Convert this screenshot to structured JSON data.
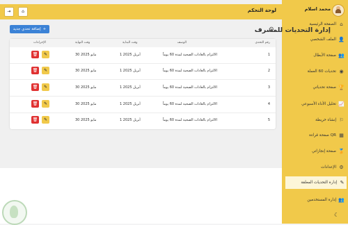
{
  "user": {
    "name": "محمد اسلام"
  },
  "topbar": {
    "title": "لوحة التحكم",
    "home_icon": "home-icon",
    "logout_icon": "logout-icon"
  },
  "sidebar": {
    "items": [
      {
        "label": "الصفحة الرئيسية",
        "icon": "home-icon"
      },
      {
        "label": "الملف الشخصي",
        "icon": "user-icon"
      },
      {
        "label": "صفحة الأبطال",
        "icon": "users-icon"
      },
      {
        "label": "تحديات 60 العملة",
        "icon": "coin-icon"
      },
      {
        "label": "صفحة تحدياتي",
        "icon": "trophy-icon"
      },
      {
        "label": "تحليل الأداء الأسبوعي",
        "icon": "chart-icon"
      },
      {
        "label": "إنشاء خريطة",
        "icon": "map-icon"
      },
      {
        "label": "صفحة قراءة QR",
        "icon": "qr-icon"
      },
      {
        "label": "صفحة إنجازاتي",
        "icon": "medal-icon"
      },
      {
        "label": "الإعدادات",
        "icon": "settings-icon"
      },
      {
        "label": "إدارة التحديات المعلقة",
        "icon": "edit-icon"
      },
      {
        "label": "إدارة المستخدمين",
        "icon": "users-icon"
      }
    ]
  },
  "page": {
    "title": "إدارة التحديات للمشرف",
    "add_button": "إضافة تحدي جديد"
  },
  "table": {
    "headers": [
      "رقم التحدي",
      "الوصف",
      "وقت البداية",
      "وقت النهاية",
      "الإجراءات"
    ],
    "rows": [
      {
        "id": "1",
        "desc": "الالتزام بالعادات الصحية لمدة 60 يوماً",
        "start": "1 أبريل 2025",
        "end": "30 مايو 2025"
      },
      {
        "id": "2",
        "desc": "الالتزام بالعادات الصحية لمدة 60 يوماً",
        "start": "1 أبريل 2025",
        "end": "30 مايو 2025"
      },
      {
        "id": "3",
        "desc": "الالتزام بالعادات الصحية لمدة 60 يوماً",
        "start": "1 أبريل 2025",
        "end": "30 مايو 2025"
      },
      {
        "id": "4",
        "desc": "الالتزام بالعادات الصحية لمدة 60 يوماً",
        "start": "1 أبريل 2025",
        "end": "30 مايو 2025"
      },
      {
        "id": "5",
        "desc": "الالتزام بالعادات الصحية لمدة 60 يوماً",
        "start": "1 أبريل 2025",
        "end": "30 مايو 2025"
      }
    ]
  },
  "theme_toggle_icon": "moon-icon",
  "colors": {
    "accent": "#f1c94a",
    "primary_button": "#3b82d6",
    "delete": "#e03131"
  }
}
